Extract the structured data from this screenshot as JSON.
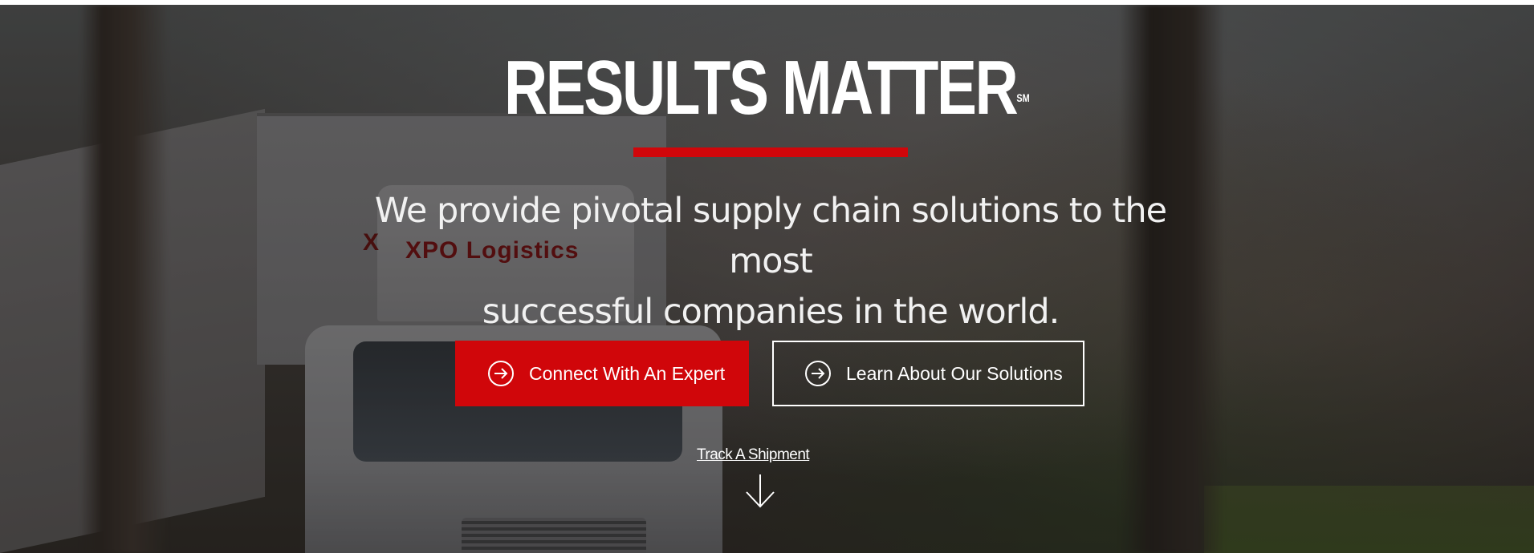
{
  "hero": {
    "headline": "RESULTS MATTER",
    "service_mark": "SM",
    "tagline_line1": "We provide pivotal supply chain solutions to the most",
    "tagline_line2": "successful companies in the world.",
    "accent_color": "#d0060a",
    "background_truck_text": {
      "logo_mark": "X",
      "logo_text": "XPO Logistics"
    }
  },
  "buttons": {
    "primary_label": "Connect With An Expert",
    "primary_icon": "circle-arrow-right-icon",
    "secondary_label": "Learn About Our Solutions",
    "secondary_icon": "circle-arrow-right-icon"
  },
  "track": {
    "label": "Track A Shipment",
    "icon": "arrow-down-icon"
  }
}
